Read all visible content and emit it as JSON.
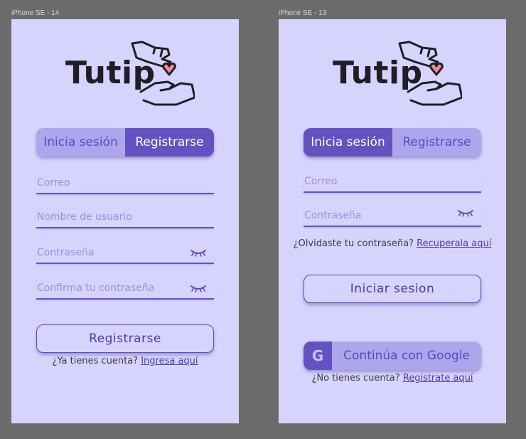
{
  "frames": [
    {
      "label": "iPhone SE - 14",
      "logo_text": "Tutip",
      "tabs": [
        "Inicia sesión",
        "Registrarse"
      ],
      "active_tab": "Registrarse",
      "fields": {
        "email_placeholder": "Correo",
        "username_placeholder": "Nombre de usuario",
        "password_placeholder": "Contraseña",
        "confirm_placeholder": "Confirma tu contraseña"
      },
      "submit_label": "Registrarse",
      "footer_prompt": "¿Ya tienes cuenta?",
      "footer_link": "Ingresa aquí"
    },
    {
      "label": "iPhone SE - 13",
      "logo_text": "Tutip",
      "tabs": [
        "Inicia sesión",
        "Registrarse"
      ],
      "active_tab": "Inicia sesión",
      "fields": {
        "email_placeholder": "Correo",
        "password_placeholder": "Contraseña"
      },
      "forgot_prompt": "¿Olvidaste tu contraseña?",
      "forgot_link": "Recuperala aquí",
      "submit_label": "Iniciar sesion",
      "google_label": "Continúa con Google",
      "google_icon_letter": "G",
      "footer_prompt": "¿No tienes cuenta?",
      "footer_link": "Registrate aquí"
    }
  ],
  "colors": {
    "background": "#6b6b6b",
    "screen": "#d6d3fd",
    "accent": "#6452c0",
    "accent_light": "#ada6ec",
    "heart": "#f08a99"
  },
  "icons": [
    "hands-heart-logo-icon",
    "eye-closed-icon",
    "google-icon"
  ]
}
